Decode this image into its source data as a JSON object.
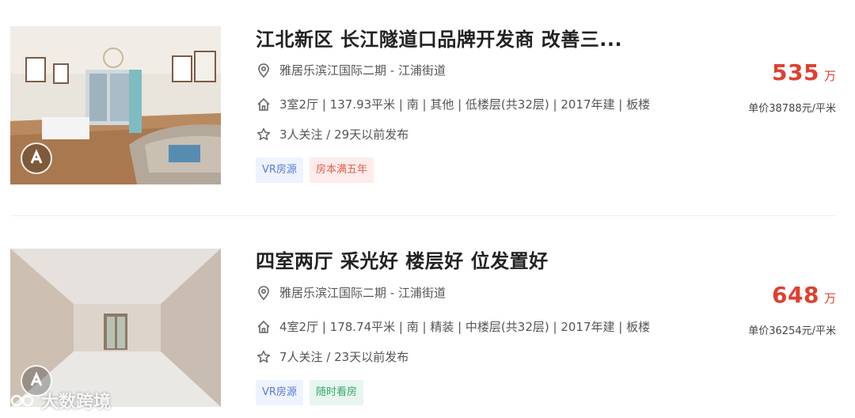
{
  "listings": [
    {
      "title": "江北新区 长江隧道口品牌开发商 改善三...",
      "community": "雅居乐滨江国际二期",
      "area": "江浦街道",
      "house_info": "3室2厅 | 137.93平米 | 南 | 其他 | 低楼层(共32层) | 2017年建 | 板楼",
      "follow_info": "3人关注 / 29天以前发布",
      "tags": [
        "VR房源",
        "房本满五年"
      ],
      "price": "535",
      "price_unit": "万",
      "unit_price": "单价38788元/平米"
    },
    {
      "title": "四室两厅 采光好 楼层好 位发置好",
      "community": "雅居乐滨江国际二期",
      "area": "江浦街道",
      "house_info": "4室2厅 | 178.74平米 | 南 | 精装 | 中楼层(共32层) | 2017年建 | 板楼",
      "follow_info": "7人关注 / 23天以前发布",
      "tags": [
        "VR房源",
        "随时看房"
      ],
      "price": "648",
      "price_unit": "万",
      "unit_price": "单价36254元/平米"
    }
  ],
  "separator": " - ",
  "watermark": "大数跨境",
  "icons": [
    "location-pin-icon",
    "house-icon",
    "star-icon",
    "vr-360-icon"
  ],
  "colors": {
    "price": "#e03f2f",
    "vr_tag_text": "#5b7bd5",
    "five_year_tag_text": "#e1614f",
    "viewing_tag_text": "#3aa86a"
  }
}
